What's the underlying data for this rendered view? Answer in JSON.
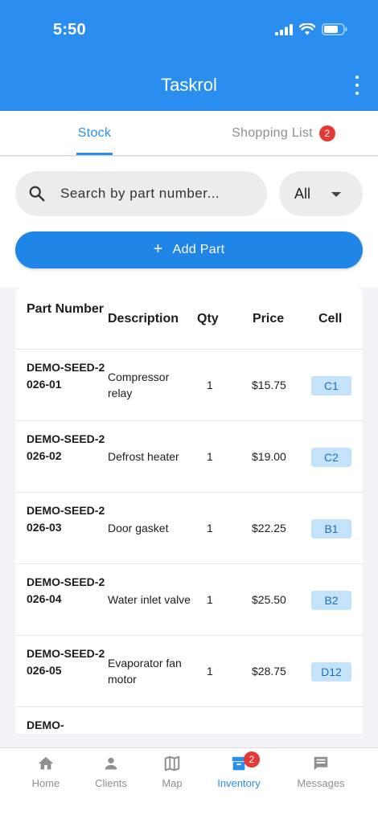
{
  "status": {
    "time": "5:50"
  },
  "app": {
    "title": "Taskrol"
  },
  "tabs": [
    {
      "label": "Stock",
      "active": true
    },
    {
      "label": "Shopping List",
      "badge": "2",
      "active": false
    }
  ],
  "search": {
    "placeholder": "Search by part number..."
  },
  "filter": {
    "selected": "All"
  },
  "add_part": {
    "label": "Add Part"
  },
  "table": {
    "headers": {
      "part": "Part Number",
      "description": "Description",
      "qty": "Qty",
      "price": "Price",
      "cell": "Cell"
    },
    "rows": [
      {
        "part": "DEMO-SEED-2026-01",
        "description": "Compressor relay",
        "qty": "1",
        "price": "$15.75",
        "cell": "C1"
      },
      {
        "part": "DEMO-SEED-2026-02",
        "description": "Defrost heater",
        "qty": "1",
        "price": "$19.00",
        "cell": "C2"
      },
      {
        "part": "DEMO-SEED-2026-03",
        "description": "Door gasket",
        "qty": "1",
        "price": "$22.25",
        "cell": "B1"
      },
      {
        "part": "DEMO-SEED-2026-04",
        "description": "Water inlet valve",
        "qty": "1",
        "price": "$25.50",
        "cell": "B2"
      },
      {
        "part": "DEMO-SEED-2026-05",
        "description": "Evaporator fan motor",
        "qty": "1",
        "price": "$28.75",
        "cell": "D12"
      },
      {
        "part": "DEMO-",
        "description": "",
        "qty": "",
        "price": "",
        "cell": ""
      }
    ]
  },
  "nav": [
    {
      "label": "Home",
      "icon": "home-icon"
    },
    {
      "label": "Clients",
      "icon": "person-icon"
    },
    {
      "label": "Map",
      "icon": "map-icon"
    },
    {
      "label": "Inventory",
      "icon": "inventory-icon",
      "badge": "2",
      "active": true
    },
    {
      "label": "Messages",
      "icon": "message-icon"
    }
  ],
  "colors": {
    "primary": "#2a8ef0",
    "badge": "#e53935",
    "cell_badge_bg": "#c5e2fb"
  }
}
